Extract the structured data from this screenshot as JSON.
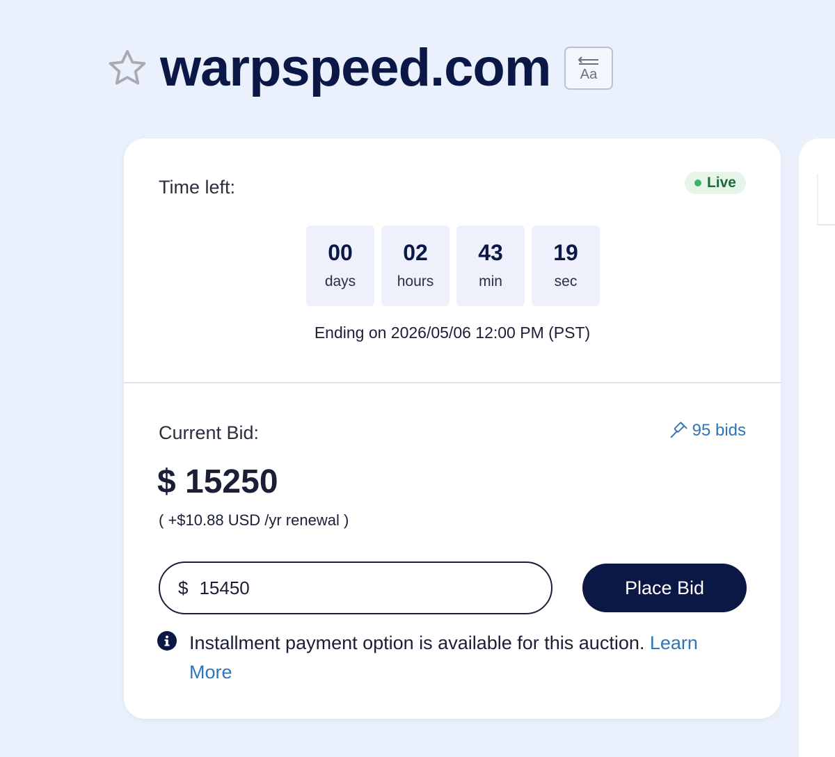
{
  "header": {
    "domain": "warpspeed.com",
    "favorite_icon": "star-outline-icon",
    "font_toggle_icon": "font-size-icon",
    "font_toggle_label": "Aa"
  },
  "timer": {
    "label": "Time left:",
    "status": "Live",
    "status_color": "#3cb464",
    "units": [
      {
        "value": "00",
        "unit": "days"
      },
      {
        "value": "02",
        "unit": "hours"
      },
      {
        "value": "43",
        "unit": "min"
      },
      {
        "value": "19",
        "unit": "sec"
      }
    ],
    "ending": "Ending on 2026/05/06 12:00 PM (PST)"
  },
  "bid": {
    "label": "Current Bid:",
    "bids_icon": "gavel-icon",
    "bids_count": "95 bids",
    "current_amount": "$ 15250",
    "renewal": "( +$10.88 USD /yr renewal )",
    "currency_symbol": "$",
    "input_value": "15450",
    "place_bid_label": "Place Bid",
    "info_icon": "info-icon",
    "info_text": "Installment payment option is available for this auction. ",
    "learn_more": "Learn More"
  },
  "colors": {
    "brand_navy": "#0b1744",
    "link_blue": "#2f74b5",
    "page_bg": "#ebf1fc"
  }
}
